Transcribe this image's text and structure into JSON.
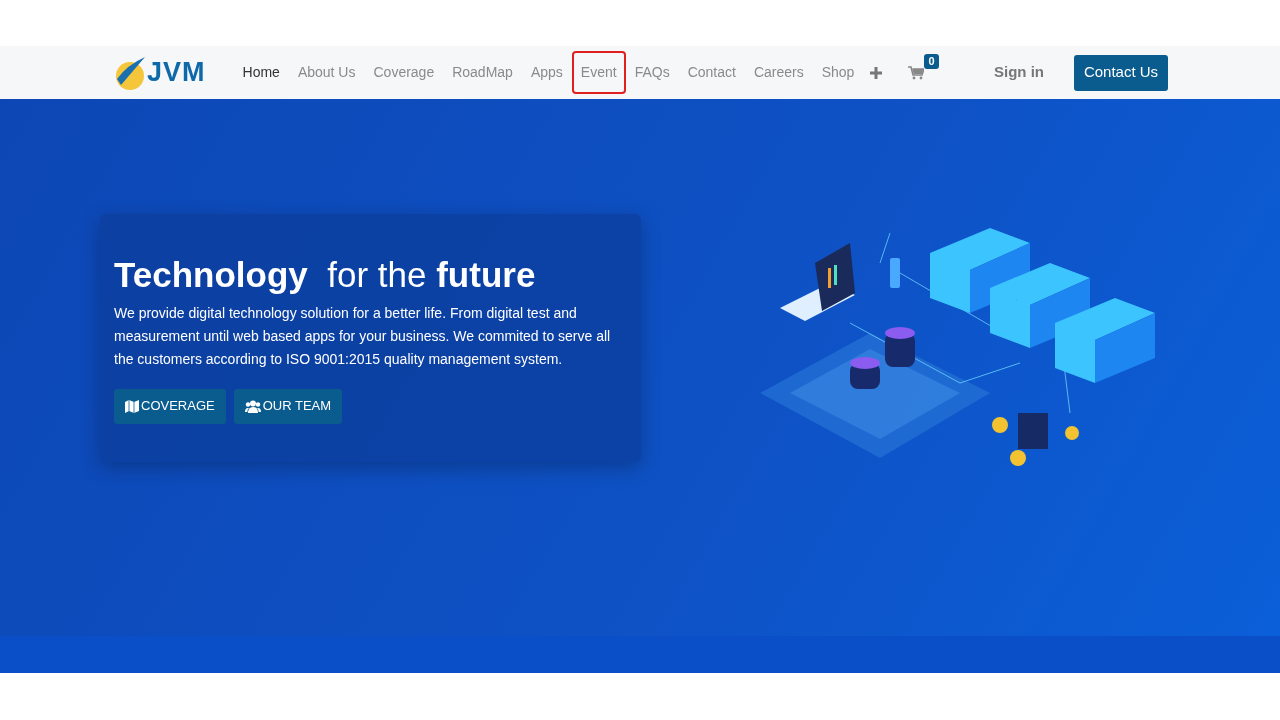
{
  "header": {
    "logo_text": "JVM",
    "nav": [
      {
        "label": "Home",
        "selected": true,
        "highlighted": false
      },
      {
        "label": "About Us",
        "selected": false,
        "highlighted": false
      },
      {
        "label": "Coverage",
        "selected": false,
        "highlighted": false
      },
      {
        "label": "RoadMap",
        "selected": false,
        "highlighted": false
      },
      {
        "label": "Apps",
        "selected": false,
        "highlighted": false
      },
      {
        "label": "Event",
        "selected": false,
        "highlighted": true
      },
      {
        "label": "FAQs",
        "selected": false,
        "highlighted": false
      },
      {
        "label": "Contact",
        "selected": false,
        "highlighted": false
      },
      {
        "label": "Careers",
        "selected": false,
        "highlighted": false
      },
      {
        "label": "Shop",
        "selected": false,
        "highlighted": false
      }
    ],
    "cart_count": "0",
    "sign_in": "Sign in",
    "contact_button": "Contact Us"
  },
  "hero": {
    "title": "**Technology**  for the **future**",
    "text": "We provide digital technology solution for a better life. From digital test and measurement until web based apps for your business. We commited to serve all the customers according to ISO 9001:2015 quality management system.",
    "buttons": [
      {
        "kind": "map",
        "label": "COVERAGE"
      },
      {
        "kind": "team",
        "label": "OUR TEAM"
      }
    ]
  }
}
